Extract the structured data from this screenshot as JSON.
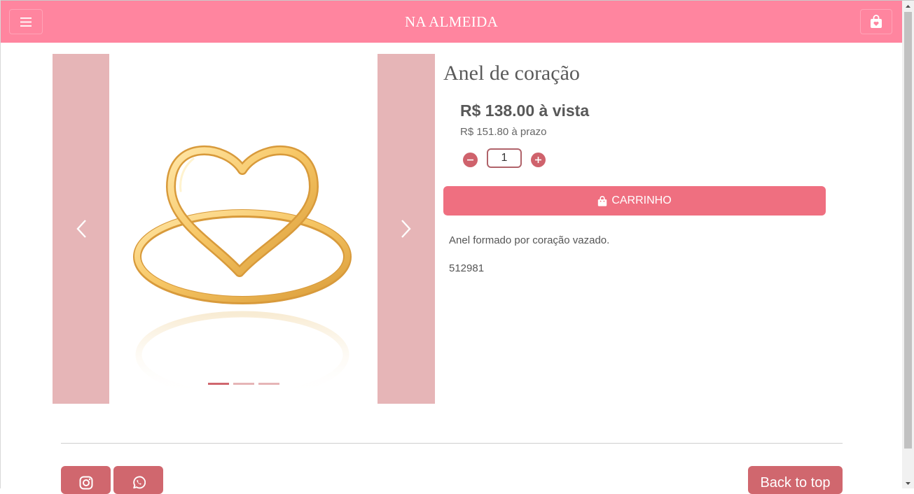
{
  "header": {
    "brand": "NA ALMEIDA",
    "menu_icon": "hamburger-icon",
    "bag_icon": "shopping-bag-heart-icon",
    "background": "#ff859f"
  },
  "carousel": {
    "prev_icon": "chevron-left-icon",
    "next_icon": "chevron-right-icon",
    "image": "gold-heart-ring",
    "slide_count": 3,
    "active_slide": 1
  },
  "product": {
    "title": "Anel de coração",
    "price_cash": "R$ 138.00 à vista",
    "price_term": "R$ 151.80 à prazo",
    "quantity": "1",
    "cart_label": "CARRINHO",
    "description": "Anel formado por coração vazado.",
    "sku": "512981"
  },
  "footer": {
    "instagram_icon": "instagram-icon",
    "whatsapp_icon": "whatsapp-icon",
    "back_to_top": "Back to top"
  },
  "colors": {
    "accent": "#d0676e",
    "cart": "#ef6f80",
    "carousel_side": "#e6b5b7"
  }
}
